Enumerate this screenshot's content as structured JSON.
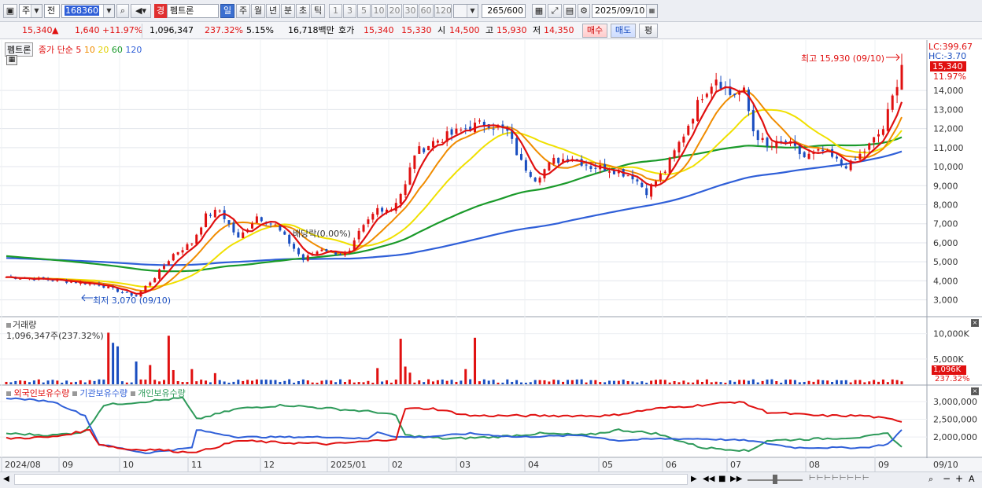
{
  "toolbar": {
    "market": "주",
    "prev": "전",
    "code": "168360",
    "name_badge": "경",
    "name": "펨트론",
    "periods": [
      "일",
      "주",
      "월",
      "년",
      "분",
      "초",
      "틱"
    ],
    "period_selected": "일",
    "intervals": [
      "1",
      "3",
      "5",
      "10",
      "20",
      "30",
      "60",
      "120"
    ],
    "count": "265",
    "count_total": "/600",
    "date": "2025/09/10"
  },
  "quote": {
    "price": "15,340",
    "arrow": "▲",
    "change": "1,640",
    "change_pct": "+11.97%",
    "volume": "1,096,347",
    "vol_ratio": "237.32%",
    "turnover": "5.15%",
    "amount": "16,718백만",
    "hoga_label": "호가",
    "ask": "15,340",
    "bid": "15,330",
    "open_label": "시",
    "open": "14,500",
    "high_label": "고",
    "high": "15,930",
    "low_label": "저",
    "low": "14,350",
    "buy_btn": "매수",
    "sell_btn": "매도",
    "eval_btn": "평"
  },
  "colors": {
    "up": "#e01010",
    "down": "#1a4ec0",
    "ma5": "#e01010",
    "ma10": "#f08c00",
    "ma20": "#f0e000",
    "ma60": "#1a9a2a",
    "ma120": "#2f5fd8",
    "foreign": "#e01010",
    "institution": "#2f5fd8",
    "individual": "#2e9a5a"
  },
  "chart_data": [
    {
      "type": "candlestick",
      "title": "펨트론",
      "legend": {
        "label": "종가 단순",
        "periods": [
          "5",
          "10",
          "20",
          "60",
          "120"
        ]
      },
      "x_months": [
        "2024/08",
        "09",
        "10",
        "11",
        "12",
        "2025/01",
        "02",
        "03",
        "04",
        "05",
        "06",
        "07",
        "08",
        "09",
        "09/10"
      ],
      "y_ticks": [
        "3,000",
        "4,000",
        "5,000",
        "6,000",
        "7,000",
        "8,000",
        "9,000",
        "10,000",
        "11,000",
        "12,000",
        "13,000",
        "14,000"
      ],
      "ylim": [
        2200,
        16400
      ],
      "header_labels": {
        "lc": "LC:399.67",
        "hc": "HC:-3.70",
        "price": "15,340",
        "pct": "11.97%"
      },
      "annotations": {
        "high": "최고 15,930 (09/10)",
        "low": "최저 3,070 (09/10)",
        "dividend": "배당락(0.00%)"
      },
      "close_anchors": [
        [
          0,
          4200
        ],
        [
          10,
          4050
        ],
        [
          20,
          3800
        ],
        [
          25,
          3400
        ],
        [
          28,
          3200
        ],
        [
          32,
          4200
        ],
        [
          36,
          5400
        ],
        [
          40,
          6000
        ],
        [
          43,
          7400
        ],
        [
          46,
          7700
        ],
        [
          50,
          6200
        ],
        [
          54,
          7400
        ],
        [
          58,
          6900
        ],
        [
          62,
          5700
        ],
        [
          64,
          5100
        ],
        [
          68,
          5700
        ],
        [
          72,
          5400
        ],
        [
          74,
          5500
        ],
        [
          76,
          6500
        ],
        [
          80,
          7800
        ],
        [
          83,
          7800
        ],
        [
          86,
          9000
        ],
        [
          88,
          10700
        ],
        [
          92,
          11300
        ],
        [
          96,
          11700
        ],
        [
          100,
          12100
        ],
        [
          104,
          12300
        ],
        [
          108,
          11800
        ],
        [
          111,
          10200
        ],
        [
          114,
          9400
        ],
        [
          118,
          10300
        ],
        [
          122,
          10500
        ],
        [
          126,
          10000
        ],
        [
          130,
          9900
        ],
        [
          135,
          9500
        ],
        [
          138,
          8700
        ],
        [
          142,
          9800
        ],
        [
          146,
          11700
        ],
        [
          150,
          13800
        ],
        [
          153,
          14700
        ],
        [
          156,
          13800
        ],
        [
          159,
          13900
        ],
        [
          161,
          11900
        ],
        [
          164,
          11000
        ],
        [
          168,
          11300
        ],
        [
          172,
          10500
        ],
        [
          176,
          10800
        ],
        [
          180,
          10100
        ],
        [
          182,
          10100
        ],
        [
          186,
          11100
        ],
        [
          189,
          12000
        ],
        [
          191,
          13600
        ],
        [
          193,
          15340
        ]
      ],
      "ma_endpoints": {
        "ma5": 13400,
        "ma10": 12600,
        "ma20": 11900,
        "ma60": 12100,
        "ma120": 11100
      }
    },
    {
      "type": "bar",
      "title": "거래량",
      "value_label": "1,096,347주(237.32%)",
      "y_ticks": [
        "10,000K",
        "5,000K"
      ],
      "current_label": "1,096K",
      "current_pct": "237.32%",
      "ylim": [
        0,
        11500
      ],
      "unit": "K",
      "spikes": [
        [
          22,
          10200
        ],
        [
          23,
          8200
        ],
        [
          24,
          7500
        ],
        [
          28,
          4500
        ],
        [
          31,
          3800
        ],
        [
          35,
          9600
        ],
        [
          36,
          2800
        ],
        [
          40,
          3000
        ],
        [
          45,
          2200
        ],
        [
          80,
          3200
        ],
        [
          85,
          9000
        ],
        [
          86,
          3500
        ],
        [
          87,
          2300
        ],
        [
          101,
          9200
        ],
        [
          99,
          3000
        ]
      ]
    },
    {
      "type": "line",
      "title": "외국인보유수량 / 기관보유수량 / 개인보유수량",
      "series": [
        {
          "name": "외국인보유수량"
        },
        {
          "name": "기관보유수량"
        },
        {
          "name": "개인보유수량"
        }
      ],
      "y_ticks": [
        "3,000,000",
        "2,500,000",
        "2,000,000"
      ],
      "ylim": [
        1450000,
        3220000
      ],
      "foreign_anchors": [
        [
          0,
          1960000
        ],
        [
          10,
          2000000
        ],
        [
          18,
          2200000
        ],
        [
          20,
          1800000
        ],
        [
          26,
          1650000
        ],
        [
          32,
          1650000
        ],
        [
          38,
          1580000
        ],
        [
          42,
          1600000
        ],
        [
          50,
          1900000
        ],
        [
          58,
          1850000
        ],
        [
          70,
          1800000
        ],
        [
          80,
          1900000
        ],
        [
          84,
          1950000
        ],
        [
          86,
          2800000
        ],
        [
          92,
          2800000
        ],
        [
          100,
          2600000
        ],
        [
          110,
          2600000
        ],
        [
          120,
          2600000
        ],
        [
          130,
          2600000
        ],
        [
          140,
          2800000
        ],
        [
          150,
          2900000
        ],
        [
          158,
          3000000
        ],
        [
          164,
          2700000
        ],
        [
          175,
          2600000
        ],
        [
          185,
          2600000
        ],
        [
          193,
          2450000
        ]
      ],
      "institution_anchors": [
        [
          0,
          3100000
        ],
        [
          10,
          3000000
        ],
        [
          17,
          2600000
        ],
        [
          20,
          1800000
        ],
        [
          30,
          1550000
        ],
        [
          40,
          1700000
        ],
        [
          41,
          2200000
        ],
        [
          50,
          2000000
        ],
        [
          60,
          2000000
        ],
        [
          70,
          2000000
        ],
        [
          78,
          1950000
        ],
        [
          80,
          2150000
        ],
        [
          84,
          2000000
        ],
        [
          90,
          2000000
        ],
        [
          100,
          2100000
        ],
        [
          110,
          2000000
        ],
        [
          124,
          2050000
        ],
        [
          132,
          1900000
        ],
        [
          140,
          1950000
        ],
        [
          150,
          1950000
        ],
        [
          160,
          1900000
        ],
        [
          170,
          1700000
        ],
        [
          185,
          1700000
        ],
        [
          190,
          1800000
        ],
        [
          193,
          2200000
        ]
      ],
      "individual_anchors": [
        [
          0,
          2100000
        ],
        [
          10,
          2050000
        ],
        [
          17,
          2150000
        ],
        [
          21,
          2900000
        ],
        [
          30,
          3000000
        ],
        [
          38,
          3100000
        ],
        [
          41,
          2500000
        ],
        [
          50,
          2800000
        ],
        [
          60,
          2900000
        ],
        [
          70,
          2800000
        ],
        [
          80,
          2700000
        ],
        [
          84,
          2600000
        ],
        [
          86,
          2050000
        ],
        [
          95,
          1950000
        ],
        [
          105,
          2000000
        ],
        [
          115,
          2100000
        ],
        [
          125,
          2050000
        ],
        [
          132,
          2200000
        ],
        [
          140,
          2100000
        ],
        [
          150,
          1700000
        ],
        [
          157,
          1650000
        ],
        [
          160,
          1600000
        ],
        [
          164,
          1900000
        ],
        [
          175,
          1950000
        ],
        [
          185,
          2000000
        ],
        [
          190,
          2100000
        ],
        [
          193,
          1700000
        ]
      ]
    }
  ],
  "bottom": {
    "scroll_left": "◀",
    "scroll_right": "▶",
    "nav": [
      "◀◀",
      "■",
      "▶▶"
    ],
    "zoom_minus": "−",
    "zoom_plus": "+",
    "a_label": "A"
  },
  "panel_icons": {
    "calc": "calc-icon",
    "close": "close-icon"
  }
}
